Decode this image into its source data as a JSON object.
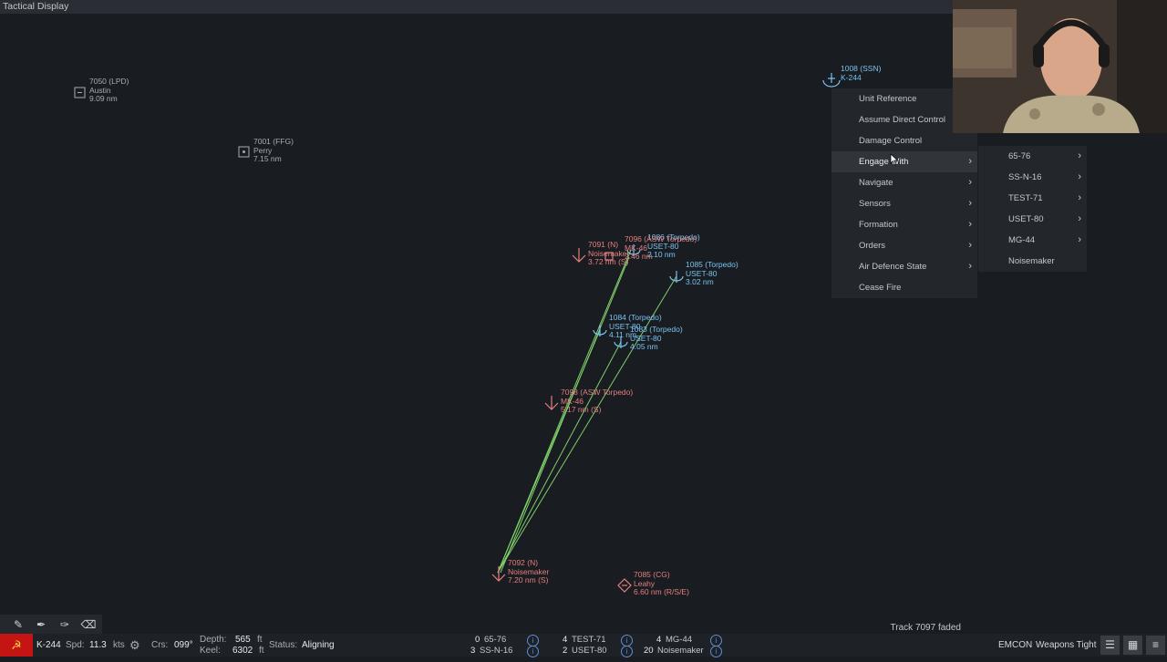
{
  "window": {
    "title": "Tactical Display"
  },
  "map": {
    "units": [
      {
        "id": "7050 (LPD)",
        "name": "Austin",
        "range": "9.09 nm"
      },
      {
        "id": "7001 (FFG)",
        "name": "Perry",
        "range": "7.15 nm"
      },
      {
        "id": "1008 (SSN)",
        "name": "K-244"
      },
      {
        "id": "1086 (Torpedo)",
        "name": "USET-80",
        "range": "2.10 nm"
      },
      {
        "id": "7091 (N)",
        "name": "Noisemaker",
        "range": "3.72 nm (S)"
      },
      {
        "id": "7096 (ASW Torpedo)",
        "name": "MK-46",
        "range": "2.46 nm"
      },
      {
        "id": "1085 (Torpedo)",
        "name": "USET-80",
        "range": "3.02 nm"
      },
      {
        "id": "1084 (Torpedo)",
        "name": "USET-80",
        "range": "4.11 nm"
      },
      {
        "id": "1083 (Torpedo)",
        "name": "USET-80",
        "range": "4.05 nm"
      },
      {
        "id": "7098 (ASW Torpedo)",
        "name": "MK-46",
        "range": "5.17 nm (S)"
      },
      {
        "id": "7092 (N)",
        "name": "Noisemaker",
        "range": "7.20 nm (S)"
      },
      {
        "id": "7085 (CG)",
        "name": "Leahy",
        "range": "6.60 nm (R/S/E)"
      }
    ]
  },
  "context_menu": {
    "items": [
      "Unit Reference",
      "Assume Direct Control",
      "Damage Control",
      "Engage With",
      "Navigate",
      "Sensors",
      "Formation",
      "Orders",
      "Air Defence State",
      "Cease Fire"
    ],
    "submenu_items": [
      "65-76",
      "SS-N-16",
      "TEST-71",
      "USET-80",
      "MG-44",
      "Noisemaker"
    ]
  },
  "status_message": "Track 7097 faded",
  "bottom_bar": {
    "unit": "K-244",
    "spd_label": "Spd:",
    "spd_value": "11.3",
    "spd_unit": "kts",
    "crs_label": "Crs:",
    "crs_value": "099°",
    "depth_label": "Depth:",
    "depth_value": "565",
    "depth_unit": "ft",
    "keel_label": "Keel:",
    "keel_value": "6302",
    "keel_unit": "ft",
    "status_label": "Status:",
    "status_value": "Aligning",
    "weapons": [
      {
        "count": "0",
        "name": "65-76"
      },
      {
        "count": "3",
        "name": "SS-N-16"
      },
      {
        "count": "4",
        "name": "TEST-71"
      },
      {
        "count": "2",
        "name": "USET-80"
      },
      {
        "count": "4",
        "name": "MG-44"
      },
      {
        "count": "20",
        "name": "Noisemaker"
      }
    ],
    "emcon": "EMCON",
    "weapons_state": "Weapons Tight"
  },
  "colors": {
    "friendly": "#79c3f1",
    "hostile": "#e57f7f",
    "neutral": "#a9adb3",
    "track_line": "#7fcf6a",
    "nation_flag": "#c41414"
  },
  "icons": [
    "pencil-icon",
    "pen-icon",
    "pin-icon",
    "eraser-icon",
    "hammer-sickle-icon",
    "info-icon",
    "layers-icon",
    "list-icon",
    "menu-icon",
    "chevron-right-icon"
  ]
}
